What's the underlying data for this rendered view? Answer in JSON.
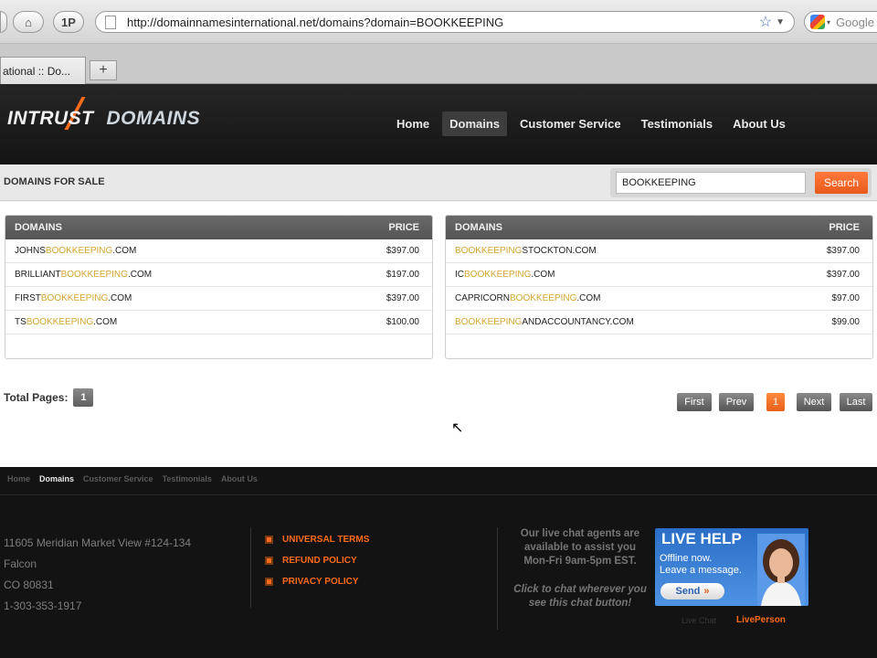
{
  "browser": {
    "home_label": "⌂",
    "onepw_label": "1P",
    "url": "http://domainnamesinternational.net/domains?domain=BOOKKEEPING",
    "search_placeholder": "Google",
    "tab_title": "ational :: Do...",
    "newtab_label": "+"
  },
  "site": {
    "logo_left": "INTRUST",
    "logo_right": "DOMAINS",
    "nav": [
      "Home",
      "Domains",
      "Customer Service",
      "Testimonials",
      "About Us"
    ],
    "active_nav": "Domains",
    "accent_color": "#ff6b1a"
  },
  "subheader": {
    "title": "DOMAINS FOR SALE",
    "search_value": "BOOKKEEPING",
    "search_button": "Search"
  },
  "tables": [
    {
      "col_domain": "DOMAINS",
      "col_price": "PRICE",
      "rows": [
        {
          "pre": "JOHNS",
          "hl": "BOOKKEEPING",
          "post": ".COM",
          "price": "$397.00"
        },
        {
          "pre": "BRILLIANT",
          "hl": "BOOKKEEPING",
          "post": ".COM",
          "price": "$197.00"
        },
        {
          "pre": "FIRST",
          "hl": "BOOKKEEPING",
          "post": ".COM",
          "price": "$397.00"
        },
        {
          "pre": "TS",
          "hl": "BOOKKEEPING",
          "post": ".COM",
          "price": "$100.00"
        }
      ]
    },
    {
      "col_domain": "DOMAINS",
      "col_price": "PRICE",
      "rows": [
        {
          "pre": "",
          "hl": "BOOKKEEPING",
          "post": "STOCKTON.COM",
          "price": "$397.00"
        },
        {
          "pre": "IC",
          "hl": "BOOKKEEPING",
          "post": ".COM",
          "price": "$397.00"
        },
        {
          "pre": "CAPRICORN",
          "hl": "BOOKKEEPING",
          "post": ".COM",
          "price": "$97.00"
        },
        {
          "pre": "",
          "hl": "BOOKKEEPING",
          "post": "ANDACCOUNTANCY.COM",
          "price": "$99.00"
        }
      ]
    }
  ],
  "pagination": {
    "total_label": "Total Pages:",
    "total": "1",
    "first": "First",
    "prev": "Prev",
    "current": "1",
    "next": "Next",
    "last": "Last"
  },
  "footer": {
    "nav": [
      "Home",
      "Domains",
      "Customer Service",
      "Testimonials",
      "About Us"
    ],
    "active_nav": "Domains",
    "address": [
      "11605 Meridian Market View #124-134",
      "Falcon",
      "CO 80831",
      "1-303-353-1917"
    ],
    "links": [
      "UNIVERSAL TERMS",
      "REFUND POLICY",
      "PRIVACY POLICY"
    ],
    "chat_text": "Our live chat agents are available to assist you Mon-Fri 9am-5pm EST.",
    "chat_text2": "Click to chat wherever you see this chat button!",
    "livehelp_title": "LIVE HELP",
    "livehelp_line1": "Offline now.",
    "livehelp_line2": "Leave a message.",
    "livehelp_send": "Send",
    "livechat_label": "Live Chat",
    "liveperson_label": "LivePerson"
  }
}
